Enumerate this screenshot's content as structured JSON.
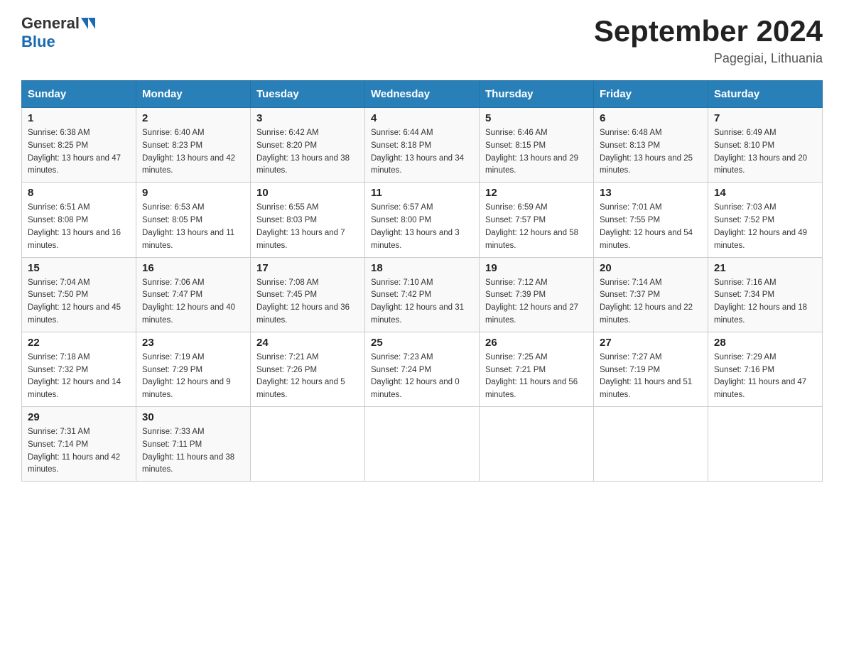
{
  "header": {
    "logo_general": "General",
    "logo_blue": "Blue",
    "title": "September 2024",
    "location": "Pagegiai, Lithuania"
  },
  "calendar": {
    "days_of_week": [
      "Sunday",
      "Monday",
      "Tuesday",
      "Wednesday",
      "Thursday",
      "Friday",
      "Saturday"
    ],
    "weeks": [
      [
        {
          "day": "1",
          "sunrise": "6:38 AM",
          "sunset": "8:25 PM",
          "daylight": "13 hours and 47 minutes."
        },
        {
          "day": "2",
          "sunrise": "6:40 AM",
          "sunset": "8:23 PM",
          "daylight": "13 hours and 42 minutes."
        },
        {
          "day": "3",
          "sunrise": "6:42 AM",
          "sunset": "8:20 PM",
          "daylight": "13 hours and 38 minutes."
        },
        {
          "day": "4",
          "sunrise": "6:44 AM",
          "sunset": "8:18 PM",
          "daylight": "13 hours and 34 minutes."
        },
        {
          "day": "5",
          "sunrise": "6:46 AM",
          "sunset": "8:15 PM",
          "daylight": "13 hours and 29 minutes."
        },
        {
          "day": "6",
          "sunrise": "6:48 AM",
          "sunset": "8:13 PM",
          "daylight": "13 hours and 25 minutes."
        },
        {
          "day": "7",
          "sunrise": "6:49 AM",
          "sunset": "8:10 PM",
          "daylight": "13 hours and 20 minutes."
        }
      ],
      [
        {
          "day": "8",
          "sunrise": "6:51 AM",
          "sunset": "8:08 PM",
          "daylight": "13 hours and 16 minutes."
        },
        {
          "day": "9",
          "sunrise": "6:53 AM",
          "sunset": "8:05 PM",
          "daylight": "13 hours and 11 minutes."
        },
        {
          "day": "10",
          "sunrise": "6:55 AM",
          "sunset": "8:03 PM",
          "daylight": "13 hours and 7 minutes."
        },
        {
          "day": "11",
          "sunrise": "6:57 AM",
          "sunset": "8:00 PM",
          "daylight": "13 hours and 3 minutes."
        },
        {
          "day": "12",
          "sunrise": "6:59 AM",
          "sunset": "7:57 PM",
          "daylight": "12 hours and 58 minutes."
        },
        {
          "day": "13",
          "sunrise": "7:01 AM",
          "sunset": "7:55 PM",
          "daylight": "12 hours and 54 minutes."
        },
        {
          "day": "14",
          "sunrise": "7:03 AM",
          "sunset": "7:52 PM",
          "daylight": "12 hours and 49 minutes."
        }
      ],
      [
        {
          "day": "15",
          "sunrise": "7:04 AM",
          "sunset": "7:50 PM",
          "daylight": "12 hours and 45 minutes."
        },
        {
          "day": "16",
          "sunrise": "7:06 AM",
          "sunset": "7:47 PM",
          "daylight": "12 hours and 40 minutes."
        },
        {
          "day": "17",
          "sunrise": "7:08 AM",
          "sunset": "7:45 PM",
          "daylight": "12 hours and 36 minutes."
        },
        {
          "day": "18",
          "sunrise": "7:10 AM",
          "sunset": "7:42 PM",
          "daylight": "12 hours and 31 minutes."
        },
        {
          "day": "19",
          "sunrise": "7:12 AM",
          "sunset": "7:39 PM",
          "daylight": "12 hours and 27 minutes."
        },
        {
          "day": "20",
          "sunrise": "7:14 AM",
          "sunset": "7:37 PM",
          "daylight": "12 hours and 22 minutes."
        },
        {
          "day": "21",
          "sunrise": "7:16 AM",
          "sunset": "7:34 PM",
          "daylight": "12 hours and 18 minutes."
        }
      ],
      [
        {
          "day": "22",
          "sunrise": "7:18 AM",
          "sunset": "7:32 PM",
          "daylight": "12 hours and 14 minutes."
        },
        {
          "day": "23",
          "sunrise": "7:19 AM",
          "sunset": "7:29 PM",
          "daylight": "12 hours and 9 minutes."
        },
        {
          "day": "24",
          "sunrise": "7:21 AM",
          "sunset": "7:26 PM",
          "daylight": "12 hours and 5 minutes."
        },
        {
          "day": "25",
          "sunrise": "7:23 AM",
          "sunset": "7:24 PM",
          "daylight": "12 hours and 0 minutes."
        },
        {
          "day": "26",
          "sunrise": "7:25 AM",
          "sunset": "7:21 PM",
          "daylight": "11 hours and 56 minutes."
        },
        {
          "day": "27",
          "sunrise": "7:27 AM",
          "sunset": "7:19 PM",
          "daylight": "11 hours and 51 minutes."
        },
        {
          "day": "28",
          "sunrise": "7:29 AM",
          "sunset": "7:16 PM",
          "daylight": "11 hours and 47 minutes."
        }
      ],
      [
        {
          "day": "29",
          "sunrise": "7:31 AM",
          "sunset": "7:14 PM",
          "daylight": "11 hours and 42 minutes."
        },
        {
          "day": "30",
          "sunrise": "7:33 AM",
          "sunset": "7:11 PM",
          "daylight": "11 hours and 38 minutes."
        },
        null,
        null,
        null,
        null,
        null
      ]
    ]
  }
}
